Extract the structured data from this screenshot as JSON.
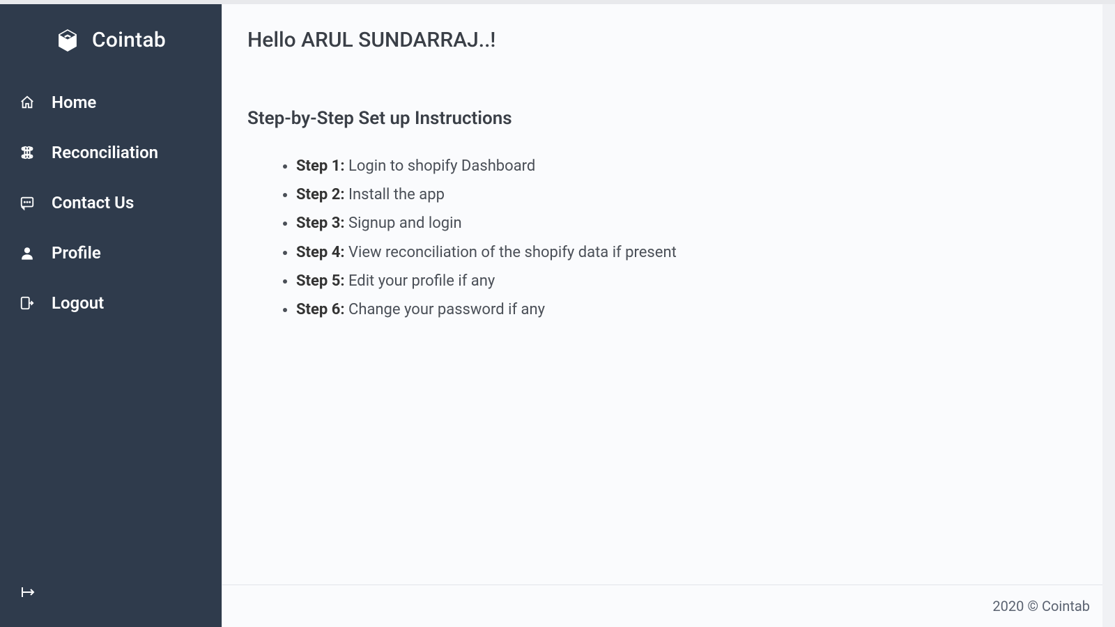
{
  "brand": {
    "name": "Cointab"
  },
  "sidebar": {
    "items": [
      {
        "label": "Home"
      },
      {
        "label": "Reconciliation"
      },
      {
        "label": "Contact Us"
      },
      {
        "label": "Profile"
      },
      {
        "label": "Logout"
      }
    ]
  },
  "main": {
    "greeting": "Hello ARUL SUNDARRAJ..!",
    "section_title": "Step-by-Step Set up Instructions",
    "steps": [
      {
        "label": "Step 1:",
        "text": " Login to shopify Dashboard"
      },
      {
        "label": "Step 2:",
        "text": " Install the app"
      },
      {
        "label": "Step 3:",
        "text": " Signup and login"
      },
      {
        "label": "Step 4:",
        "text": " View reconciliation of the shopify data if present"
      },
      {
        "label": "Step 5:",
        "text": " Edit your profile if any"
      },
      {
        "label": "Step 6:",
        "text": " Change your password if any"
      }
    ]
  },
  "footer": {
    "text": "2020 © Cointab"
  }
}
